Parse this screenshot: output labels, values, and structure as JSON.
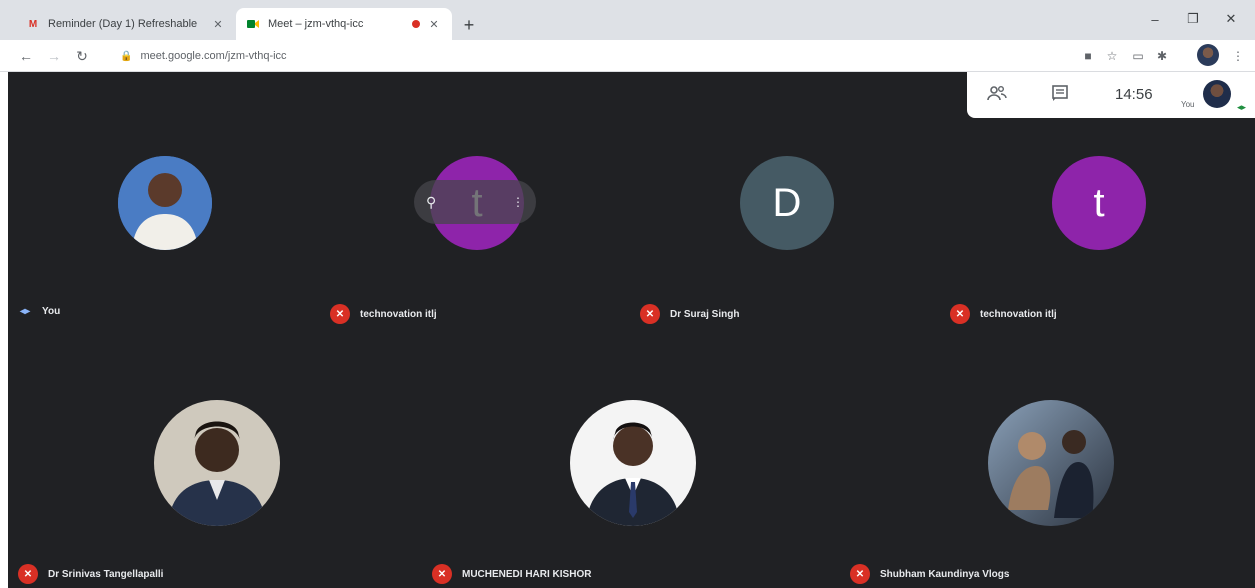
{
  "browser": {
    "tabs": [
      {
        "title": "Reminder (Day 1) Refreshable",
        "icon": "gmail-icon",
        "active": false
      },
      {
        "title": "Meet – jzm-vthq-icc",
        "icon": "meet-icon",
        "active": true
      }
    ],
    "url": "meet.google.com/jzm-vthq-icc",
    "new_tab_label": "+",
    "window_controls": {
      "minimize": "–",
      "restore": "❐",
      "close": "✕"
    }
  },
  "meet": {
    "clock": "14:56",
    "self_label": "You",
    "colors": {
      "background": "#202124",
      "mic_off": "#d93025",
      "purple_avatar": "#8e24aa",
      "gray_avatar": "#455a64"
    },
    "participants": [
      {
        "name": "You",
        "avatar_type": "photo",
        "muted": false
      },
      {
        "name": "technovation itlj",
        "avatar_type": "letter",
        "letter": "t",
        "color": "#8e24aa",
        "muted": true
      },
      {
        "name": "Dr Suraj Singh",
        "avatar_type": "letter",
        "letter": "D",
        "color": "#455a64",
        "muted": true
      },
      {
        "name": "technovation itlj",
        "avatar_type": "letter",
        "letter": "t",
        "color": "#8e24aa",
        "muted": true
      },
      {
        "name": "Dr Srinivas Tangellapalli",
        "avatar_type": "photo",
        "muted": true
      },
      {
        "name": "MUCHENEDI HARI KISHOR",
        "avatar_type": "photo",
        "muted": true
      },
      {
        "name": "Shubham Kaundinya Vlogs",
        "avatar_type": "photo",
        "muted": true
      }
    ]
  }
}
